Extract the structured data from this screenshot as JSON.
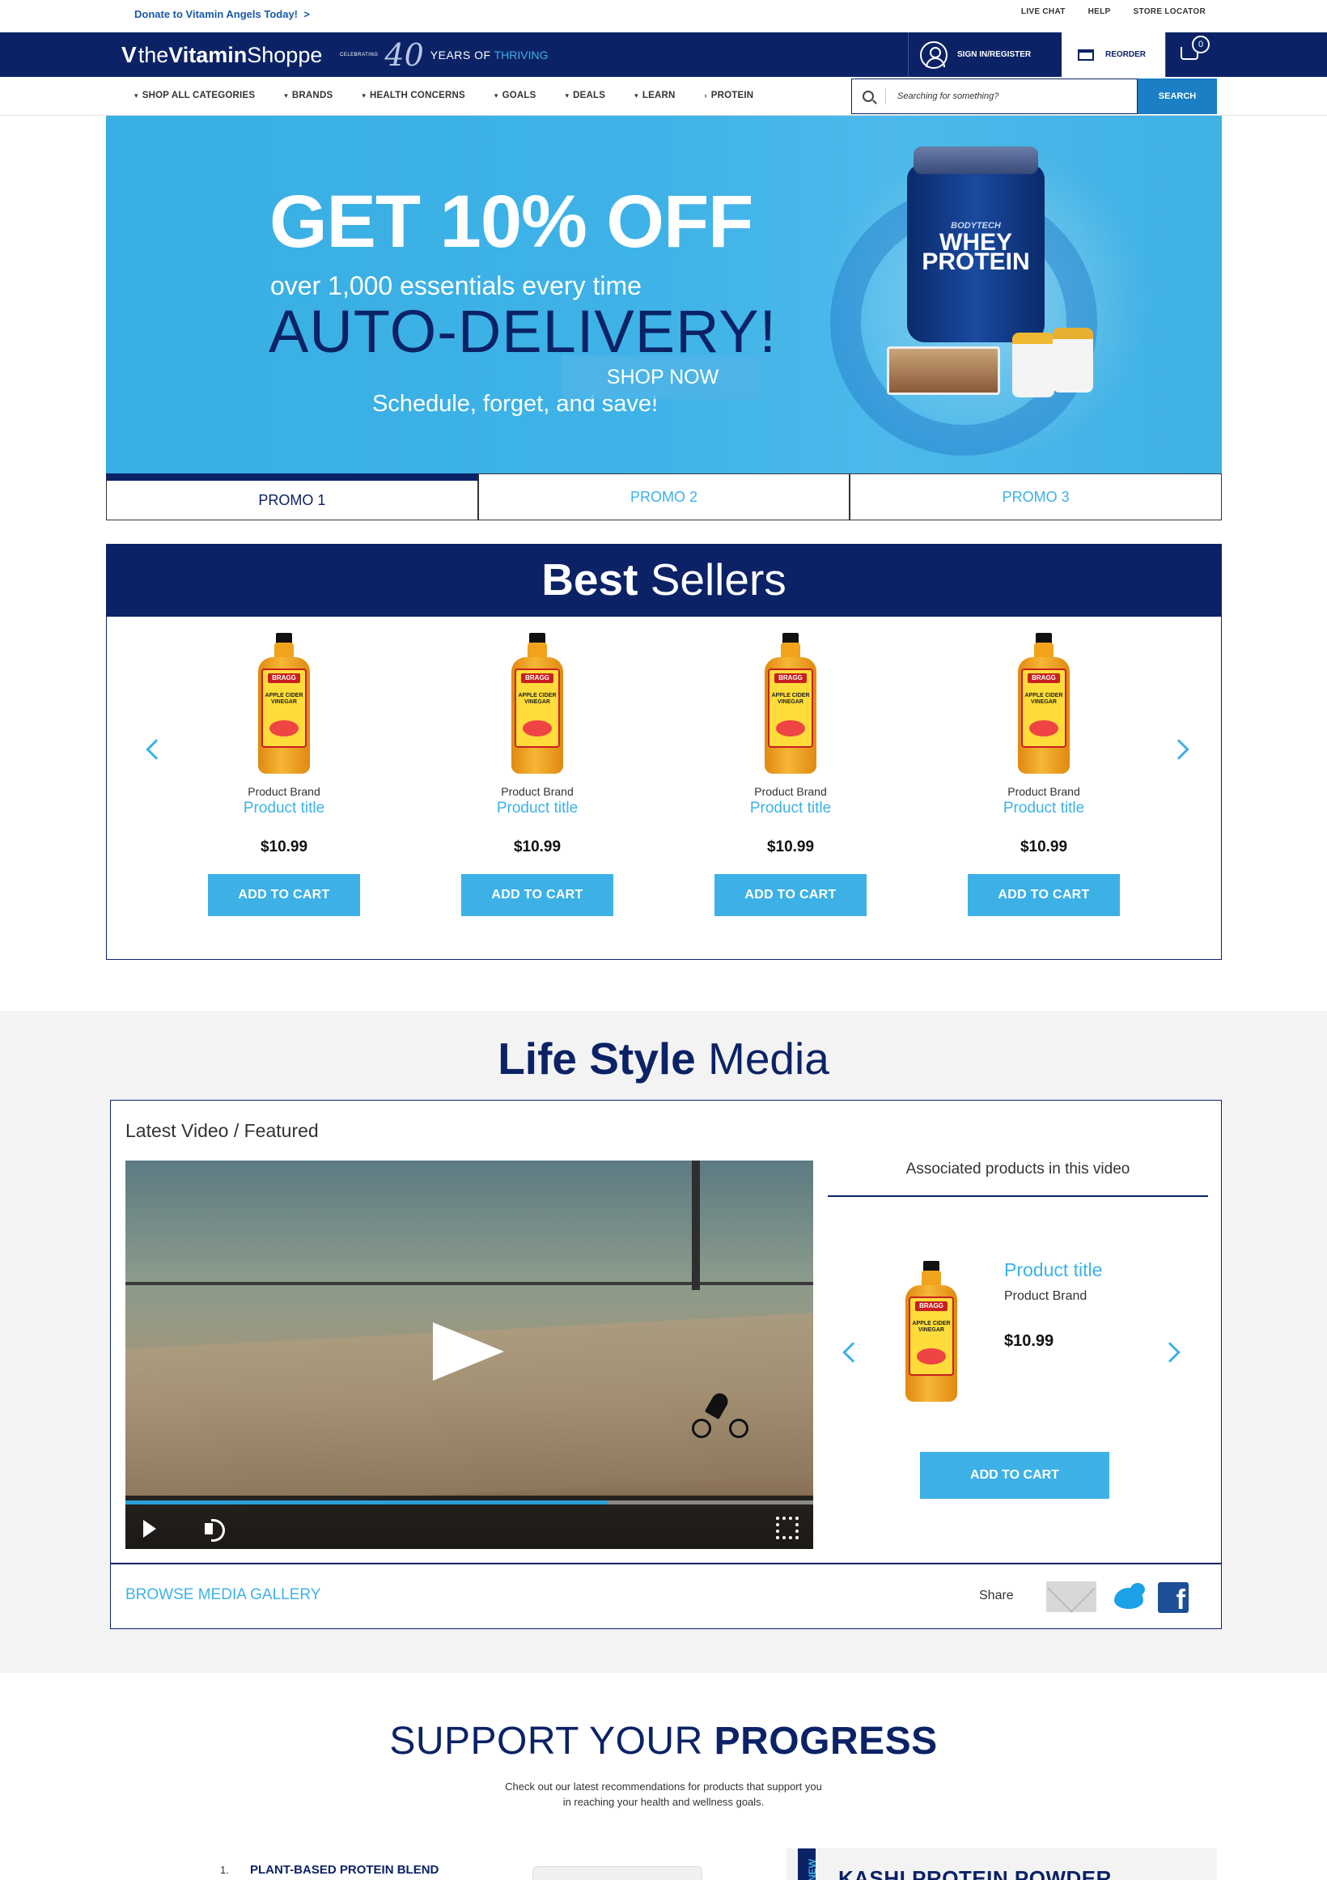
{
  "utility": {
    "donate": "Donate to Vitamin Angels Today!",
    "donate_arrow": ">",
    "links": [
      "LIVE CHAT",
      "HELP",
      "STORE LOCATOR"
    ]
  },
  "header": {
    "logo_v": "V",
    "logo_the": "the",
    "logo_vitamin": "Vitamin",
    "logo_shoppe": "Shoppe",
    "celebrating": "CELEBRATING",
    "forty": "40",
    "years": "YEARS OF",
    "thriving": "THRIVING",
    "sign_in": "SIGN IN/REGISTER",
    "reorder": "REORDER",
    "cart_count": "0"
  },
  "nav": {
    "items": [
      "SHOP ALL CATEGORIES",
      "BRANDS",
      "HEALTH CONCERNS",
      "GOALS",
      "DEALS",
      "LEARN",
      "PROTEIN"
    ],
    "search_placeholder": "Searching for something?",
    "search_button": "SEARCH"
  },
  "hero": {
    "headline": "GET 10% OFF",
    "subline": "over 1,000 essentials every time",
    "title": "AUTO-DELIVERY!",
    "tagline": "Schedule, forget, and save!",
    "cta": "SHOP NOW",
    "jar_brand": "BODYTECH",
    "jar_label": "WHEY PROTEIN",
    "tabs": [
      "PROMO 1",
      "PROMO 2",
      "PROMO 3"
    ],
    "active_tab_index": 0
  },
  "best_sellers": {
    "title_bold": "Best",
    "title_light": "Sellers",
    "products": [
      {
        "brand": "Product Brand",
        "title": "Product title",
        "price": "$10.99",
        "cta": "ADD TO CART",
        "bottle_top": "BRAGG",
        "bottle_text": "APPLE CIDER VINEGAR"
      },
      {
        "brand": "Product Brand",
        "title": "Product title",
        "price": "$10.99",
        "cta": "ADD TO CART",
        "bottle_top": "BRAGG",
        "bottle_text": "APPLE CIDER VINEGAR"
      },
      {
        "brand": "Product Brand",
        "title": "Product title",
        "price": "$10.99",
        "cta": "ADD TO CART",
        "bottle_top": "BRAGG",
        "bottle_text": "APPLE CIDER VINEGAR"
      },
      {
        "brand": "Product Brand",
        "title": "Product title",
        "price": "$10.99",
        "cta": "ADD TO CART",
        "bottle_top": "BRAGG",
        "bottle_text": "APPLE CIDER VINEGAR"
      }
    ]
  },
  "lifestyle": {
    "title_bold": "Life Style",
    "title_light": "Media",
    "latest": "Latest Video / Featured",
    "video_progress": 0.7,
    "associated": "Associated products in this video",
    "product": {
      "title": "Product title",
      "brand": "Product Brand",
      "price": "$10.99",
      "cta": "ADD TO CART",
      "bottle_top": "BRAGG",
      "bottle_text": "APPLE CIDER VINEGAR"
    },
    "browse": "BROWSE MEDIA GALLERY",
    "share": "Share",
    "facebook": "f"
  },
  "support": {
    "title_light": "SUPPORT YOUR",
    "title_bold": "PROGRESS",
    "subtitle": "Check out our latest recommendations for products that support you in reaching your health and wellness goals.",
    "list_num": "1.",
    "list_item": "PLANT-BASED PROTEIN BLEND",
    "card_tag": "NEW",
    "card_title": "KASHI PROTEIN POWDER"
  },
  "colors": {
    "navy": "#0b2266",
    "accent": "#3db1e6",
    "hero_bg": "#3fb3e7"
  }
}
